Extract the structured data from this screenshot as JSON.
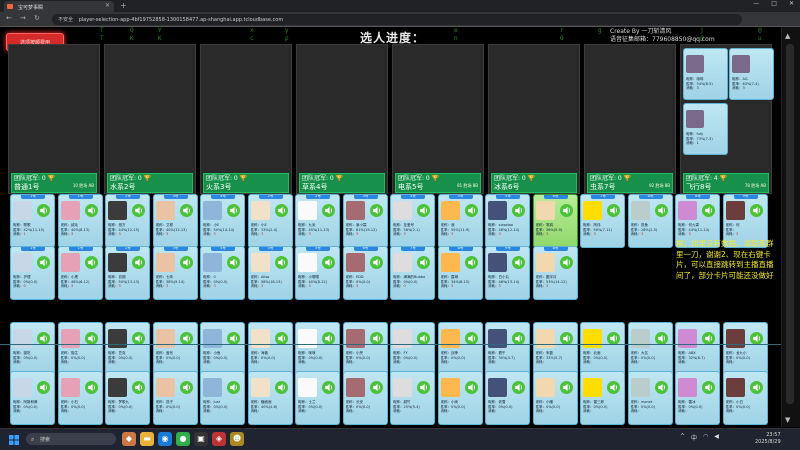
{
  "browser": {
    "tab_title": "宝可梦事瞬",
    "url_warning": "不安全",
    "url": "player-selection-app-4bf19752858-1300158477.ap-shanghai.app.tcloudbase.com",
    "window_controls": [
      "—",
      "□",
      "✕"
    ]
  },
  "app": {
    "clear_button": "选项按顺费用",
    "title": "选人进度：",
    "credit_line1": "Create By 一刀斩清风",
    "credit_line2": "语音征集邮箱：779608850@qq.com",
    "matrix_chars": [
      "T",
      "Y",
      "Q",
      "K",
      "x",
      "c",
      "y",
      "p",
      "e",
      "n",
      "r",
      "O",
      "g",
      "T",
      "j",
      "@",
      "u"
    ],
    "notice": "据；如果没有数据，请联系群里一刀，谢谢2、现在右键卡片，可以直接跳转到主播直播间了，部分卡片可能还没做好"
  },
  "teams": [
    {
      "header": "团队冠军: 0 🏆",
      "name": "普通1号",
      "score": "10 胜场 AB"
    },
    {
      "header": "团队冠军: 0 🏆",
      "name": "水系2号",
      "score": ""
    },
    {
      "header": "团队冠军: 0 🏆",
      "name": "火系3号",
      "score": ""
    },
    {
      "header": "团队冠军: 0 🏆",
      "name": "草系4号",
      "score": ""
    },
    {
      "header": "团队冠军: 0 🏆",
      "name": "电系5号",
      "score": "81 胜场 8B"
    },
    {
      "header": "团队冠军: 0 🏆",
      "name": "冰系6号",
      "score": ""
    },
    {
      "header": "团队冠军: 0 🏆",
      "name": "虫系7号",
      "score": "92 胜场 8B"
    },
    {
      "header": "团队冠军: 4 🏆",
      "name": "飞行8号",
      "score": "78 胜场 AB"
    }
  ],
  "slot8_players": [
    {
      "name": "昵称：咖啡",
      "rate": "胜率：54%(8-5)",
      "cost": "消耗：3"
    },
    {
      "name": "昵称：AG",
      "rate": "胜率：63%(7-4)",
      "cost": "消耗：3"
    },
    {
      "name": "昵称：fufy",
      "rate": "胜率：73%(7-3)",
      "cost": "消耗：1"
    }
  ],
  "row1": [
    {
      "tag": "1号",
      "name": "昵称：歌歌",
      "rate": "42%(11-15)",
      "cost": "1",
      "lit": false
    },
    {
      "tag": "1号",
      "name": "昵称：绒毛",
      "rate": "40%(8-13)",
      "cost": "3",
      "lit": false
    },
    {
      "tag": "2号",
      "name": "昵称：悠方",
      "rate": "44%(12-15)",
      "cost": "3",
      "lit": false
    },
    {
      "tag": "3号",
      "name": "昵称：艾柳",
      "rate": "40%(12-13)",
      "cost": "3",
      "lit": false
    },
    {
      "tag": "4号",
      "name": "昵称：小E",
      "rate": "50%(14-14)",
      "cost": "3",
      "lit": false
    },
    {
      "tag": "2号",
      "name": "昵称：小E",
      "rate": "33%(2-4)",
      "cost": "3",
      "lit": false
    },
    {
      "tag": "2号",
      "name": "昵称：九米",
      "rate": "45%(11-13)",
      "cost": "3",
      "lit": false
    },
    {
      "tag": "3号",
      "name": "昵称：景小霖",
      "rate": "61%(19-12)",
      "cost": "3",
      "lit": false
    },
    {
      "tag": "4号",
      "name": "昵称：至爱号",
      "rate": "56%(2-1)",
      "cost": "3",
      "lit": false
    },
    {
      "tag": "5号",
      "name": "昵称：我",
      "rate": "55%(11-9)",
      "cost": "3",
      "lit": false
    },
    {
      "tag": "5号",
      "name": "昵称：xiaoxiao",
      "rate": "46%(12-14)",
      "cost": "3",
      "lit": false
    },
    {
      "tag": "6号",
      "name": "昵称：笔鸦",
      "rate": "36%(5-9)",
      "cost": "3",
      "lit": true
    },
    {
      "tag": "7号",
      "name": "昵称：阿伟",
      "rate": "50%(7-11)",
      "cost": "3",
      "lit": false
    },
    {
      "tag": "8号",
      "name": "昵称：孤鱼",
      "rate": "28%(2-5)",
      "cost": "3",
      "lit": false
    },
    {
      "tag": "8号",
      "name": "昵称：何九霄",
      "rate": "44%(11-14)",
      "cost": "3",
      "lit": false
    },
    {
      "tag": "9号",
      "name": "昵称：何",
      "rate": "",
      "cost": "3",
      "lit": false
    }
  ],
  "row2": [
    {
      "tag": "1号",
      "name": "昵称：护理",
      "rate": "0%(0-0)",
      "cost": "0",
      "lit": false
    },
    {
      "tag": "1号",
      "name": "昵称：小黑",
      "rate": "46%(6-12)",
      "cost": "3",
      "lit": false
    },
    {
      "tag": "2号",
      "name": "昵称：初期",
      "rate": "50%(13-13)",
      "cost": "3",
      "lit": false
    },
    {
      "tag": "3号",
      "name": "昵称：七砖",
      "rate": "38%(9-14)",
      "cost": "3",
      "lit": false
    },
    {
      "tag": "4号",
      "name": "昵称：0",
      "rate": "0%(0-0)",
      "cost": "3",
      "lit": false
    },
    {
      "tag": "5号",
      "name": "昵称：Alisa",
      "rate": "58%(18-13)",
      "cost": "3",
      "lit": false
    },
    {
      "tag": "5号",
      "name": "昵称：小嘤嘤",
      "rate": "40%(8-12)",
      "cost": "3",
      "lit": false
    },
    {
      "tag": "6号",
      "name": "昵称：EDD",
      "rate": "0%(0-0)",
      "cost": "3",
      "lit": false
    },
    {
      "tag": "7号",
      "name": "昵称：满满的Bubbo",
      "rate": "0%(0-0)",
      "cost": "0",
      "lit": false
    },
    {
      "tag": "8号",
      "name": "昵称：露琳",
      "rate": "34%(8-15)",
      "cost": "3",
      "lit": false
    },
    {
      "tag": "9号",
      "name": "昵称：白小丸",
      "rate": "46%(13-14)",
      "cost": "3",
      "lit": false
    },
    {
      "tag": "8号",
      "name": "昵称：圆半月",
      "rate": "53%(14-12)",
      "cost": "3",
      "lit": false
    }
  ],
  "row3": [
    {
      "name": "昵称：猫吃",
      "rate": "0%(0-0)"
    },
    {
      "name": "昵称：猫生",
      "rate": "0%(0-0)"
    },
    {
      "name": "昵称：豆克",
      "rate": "0%(0-0)"
    },
    {
      "name": "昵称：盖布",
      "rate": "0%(0-0)"
    },
    {
      "name": "昵称：小鱼",
      "rate": "0%(0-0)"
    },
    {
      "name": "昵称：海兽",
      "rate": "0%(0-0)"
    },
    {
      "name": "昵称：咪咪",
      "rate": "0%(0-0)"
    },
    {
      "name": "昵称：小兜",
      "rate": "0%(0-0)"
    },
    {
      "name": "昵称：FY",
      "rate": "0%(0-0)"
    },
    {
      "name": "昵称：战神",
      "rate": "0%(0-0)"
    },
    {
      "name": "昵称：看午",
      "rate": "30%(4-7)"
    },
    {
      "name": "昵称：宋磊",
      "rate": "33%(5-7)"
    },
    {
      "name": "昵称：北面",
      "rate": "0%(0-0)"
    },
    {
      "name": "昵称：大名",
      "rate": "0%(0-0)"
    },
    {
      "name": "昵称：ABX",
      "rate": "32%(6-7)"
    },
    {
      "name": "昵称：龙九小",
      "rate": "0%(0-0)"
    }
  ],
  "row4": [
    {
      "name": "昵称：阿斯和甫",
      "rate": "0%(0-0)"
    },
    {
      "name": "昵称：小石",
      "rate": "0%(0-0)"
    },
    {
      "name": "昵称：梦歌九",
      "rate": "0%(0-0)"
    },
    {
      "name": "昵称：孤子",
      "rate": "0%(0-0)"
    },
    {
      "name": "昵称：Just",
      "rate": "0%(0-0)"
    },
    {
      "name": "昵称：糖面面",
      "rate": "40%(4-6)"
    },
    {
      "name": "昵称：士兰",
      "rate": "0%(0-0)"
    },
    {
      "name": "昵称：长安",
      "rate": "0%(0-0)"
    },
    {
      "name": "昵称：越竹",
      "rate": "25%(5-4)"
    },
    {
      "name": "昵称：小雨",
      "rate": "0%(0-0)"
    },
    {
      "name": "昵称：老雪",
      "rate": "0%(0-0)"
    },
    {
      "name": "昵称：小暖",
      "rate": "0%(0-0)"
    },
    {
      "name": "昵称：雷三郎",
      "rate": "0%(0-0)"
    },
    {
      "name": "昵称：monet",
      "rate": "0%(0-0)"
    },
    {
      "name": "昵称：雷冰",
      "rate": "0%(0-0)"
    },
    {
      "name": "昵称：小白",
      "rate": "0%(0-0)"
    }
  ],
  "labels": {
    "rate_prefix": "胜率：",
    "cost_prefix": "消耗："
  },
  "taskbar": {
    "search": "搜索",
    "tray": "中",
    "time": "23:57",
    "date": "2025/8/29"
  }
}
